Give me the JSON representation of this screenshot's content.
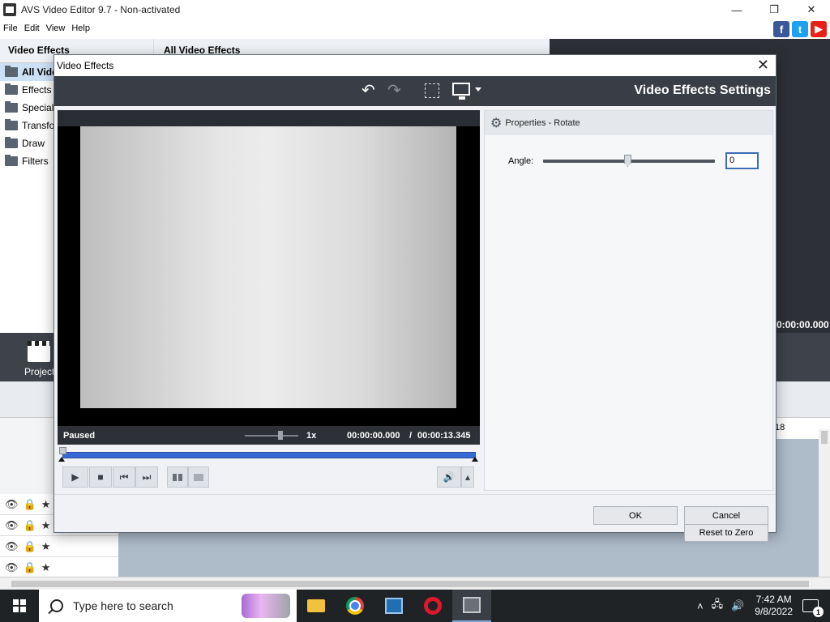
{
  "window": {
    "title": "AVS Video Editor 9.7 - Non-activated",
    "minimize": "—",
    "restore": "❐",
    "close": "✕"
  },
  "menu": [
    "File",
    "Edit",
    "View",
    "Help"
  ],
  "social": {
    "facebook": "f",
    "twitter": "t",
    "youtube": "▶"
  },
  "left_panel": {
    "header": "Video Effects",
    "items": [
      {
        "label": "All Vide",
        "selected": true
      },
      {
        "label": "Effects"
      },
      {
        "label": "Special"
      },
      {
        "label": "Transfor"
      },
      {
        "label": "Draw"
      },
      {
        "label": "Filters"
      }
    ]
  },
  "mid_panel": {
    "header": "All Video Effects"
  },
  "background": {
    "time": "0:00:00.000",
    "project_label": "Project",
    "ruler_mark": "18"
  },
  "dialog": {
    "title": "Video Effects",
    "close": "✕",
    "heading": "Video Effects Settings",
    "toolbar": {
      "undo": "↶",
      "redo": "↷"
    },
    "player": {
      "status": "Paused",
      "speed": "1x",
      "current_time": "00:00:00.000",
      "separator": "/",
      "total_time": "00:00:13.345",
      "playhead_fraction": 0
    },
    "controls": {
      "play": "▶",
      "stop": "■",
      "prev": "⏮",
      "next": "⏭",
      "volume": "🔊",
      "volume_menu": "▴"
    },
    "properties": {
      "header": "Properties - Rotate",
      "angle_label": "Angle:",
      "angle_value": "0",
      "reset_label": "Reset to Zero"
    },
    "ok_label": "OK",
    "cancel_label": "Cancel"
  },
  "taskbar": {
    "search_placeholder": "Type here to search",
    "time": "7:42 AM",
    "date": "9/8/2022",
    "notification_count": "1"
  },
  "colors": {
    "accent": "#3769d6",
    "dark_panel": "#393d45",
    "taskbar": "#202326"
  }
}
